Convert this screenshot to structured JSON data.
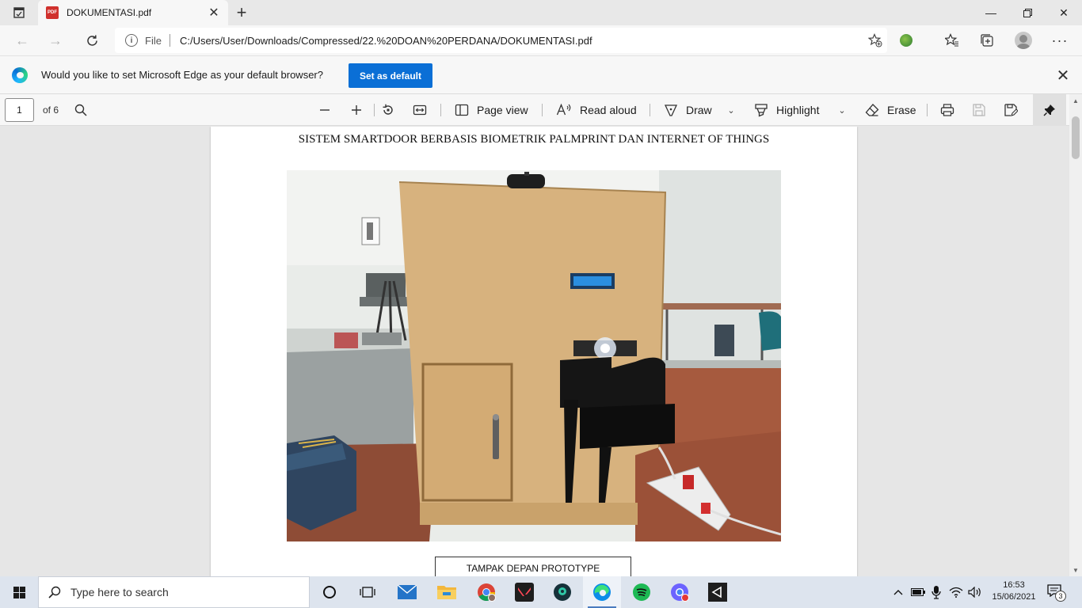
{
  "tab": {
    "title": "DOKUMENTASI.pdf",
    "favicon_text": "PDF"
  },
  "address": {
    "scheme_label": "File",
    "url": "C:/Users/User/Downloads/Compressed/22.%20DOAN%20PERDANA/DOKUMENTASI.pdf"
  },
  "infobar": {
    "message": "Would you like to set Microsoft Edge as your default browser?",
    "button": "Set as default"
  },
  "pdf_toolbar": {
    "page_number": "1",
    "page_of": "of 6",
    "page_view": "Page view",
    "read_aloud": "Read aloud",
    "draw": "Draw",
    "highlight": "Highlight",
    "erase": "Erase"
  },
  "document": {
    "title": "SISTEM SMARTDOOR BERBASIS BIOMETRIK PALMPRINT DAN INTERNET OF THINGS",
    "caption": "TAMPAK DEPAN PROTOTYPE"
  },
  "taskbar": {
    "search_placeholder": "Type here to search",
    "time": "16:53",
    "date": "15/06/2021",
    "notification_count": "3"
  },
  "colors": {
    "accent": "#0a6fd6",
    "taskbar": "#dde4ee",
    "toolbar": "#f7f7f7"
  }
}
